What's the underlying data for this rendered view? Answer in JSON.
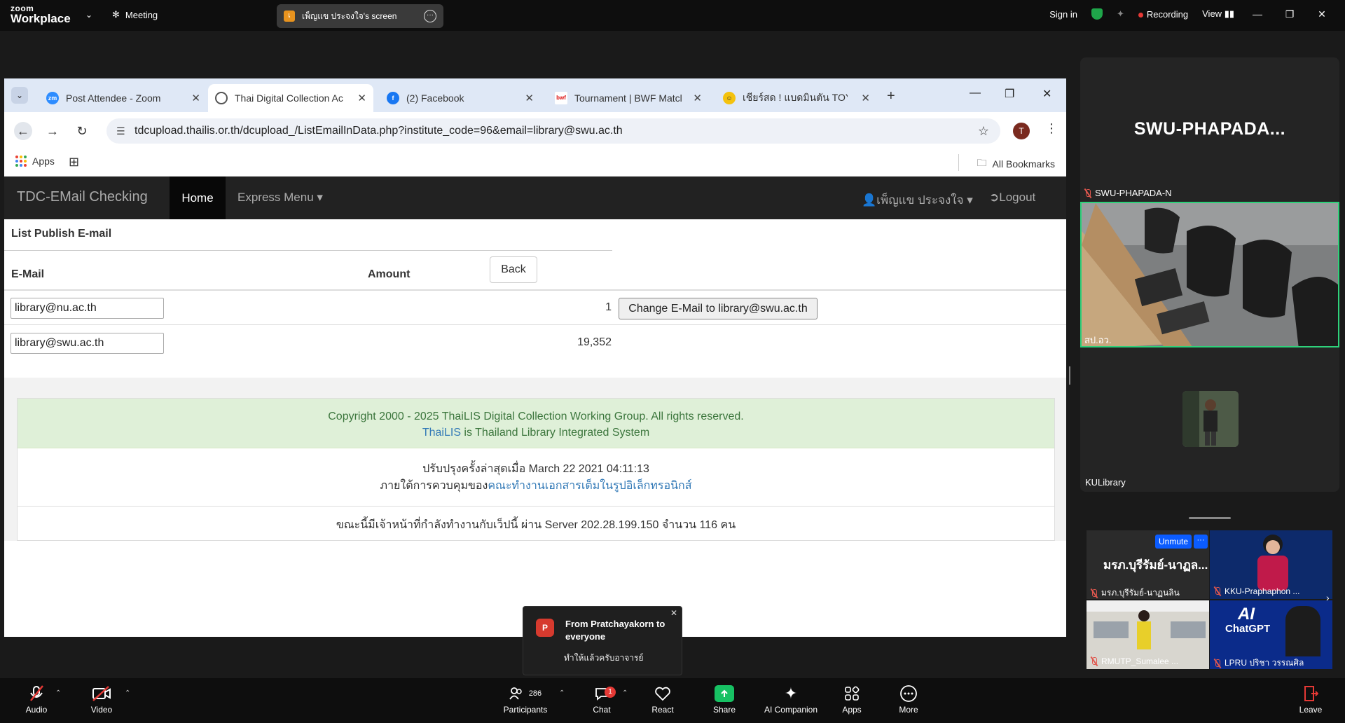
{
  "zoom": {
    "logo_small": "zoom",
    "logo_big": "Workplace",
    "meeting_label": "Meeting",
    "share_badge": "เ",
    "share_text": "เพ็ญแข ประจงใจ's screen",
    "sign_in": "Sign in",
    "recording": "Recording",
    "view": "View"
  },
  "browser": {
    "tabs": [
      {
        "title": "Post Attendee - Zoom",
        "favicon": "zm"
      },
      {
        "title": "Thai Digital Collection Ac",
        "favicon": "globe"
      },
      {
        "title": "(2) Facebook",
        "favicon": "f"
      },
      {
        "title": "Tournament | BWF Matcl",
        "favicon": "bwf"
      },
      {
        "title": "เชียร์สด ! แบดมินตัน TOYOT",
        "favicon": "emoji"
      }
    ],
    "url": "tdcupload.thailis.or.th/dcupload_/ListEmailInData.php?institute_code=96&email=library@swu.ac.th",
    "profile_initial": "T",
    "bookmarks_apps": "Apps",
    "all_bookmarks": "All Bookmarks"
  },
  "site": {
    "brand": "TDC-EMail Checking",
    "home": "Home",
    "express_menu": "Express Menu",
    "user": "เพ็ญแข ประจงใจ",
    "logout": "Logout",
    "list_title": "List Publish E-mail",
    "back": "Back",
    "col_email": "E-Mail",
    "col_amount": "Amount",
    "rows": [
      {
        "email": "library@nu.ac.th",
        "amount": "1",
        "action": "Change E-Mail to library@swu.ac.th"
      },
      {
        "email": "library@swu.ac.th",
        "amount": "19,352",
        "action": ""
      }
    ],
    "footer": {
      "copyright": "Copyright 2000 - 2025 ThaiLIS Digital Collection Working Group. All rights reserved.",
      "thailis_link": "ThaiLIS",
      "thailis_rest": " is Thailand Library Integrated System",
      "updated": "ปรับปรุงครั้งล่าสุดเมื่อ March 22 2021 04:11:13",
      "control_prefix": "ภายใต้การควบคุมของ",
      "control_link": "คณะทำงานเอกสารเต็มในรูปอิเล็กทรอนิกส์",
      "online": "ขณะนี้มีเจ้าหน้าที่กำลังทำงานกับเว็ปนี้ ผ่าน Server 202.28.199.150 จำนวน 116 คน"
    }
  },
  "gallery": {
    "top_tile_name": "SWU-PHAPADA...",
    "top_tile_label": "SWU-PHAPADA-N",
    "video_label": "สป.อว.",
    "kul_label": "KULibrary",
    "thumbs": [
      {
        "name": "มรภ.บุรีรัมย์-นาฏล...",
        "label": "มรภ.บุรีรัมย์-นาฏนลิน"
      },
      {
        "label": "KKU-Praphaphon ..."
      },
      {
        "label": "RMUTP_Sumalee ..."
      },
      {
        "label": "LPRU ปริชา วรรณศิล",
        "title": "AI",
        "subtitle": "ChatGPT"
      }
    ],
    "unmute": "Unmute"
  },
  "toast": {
    "initial": "P",
    "from": "From Pratchayakorn to everyone",
    "message": "ทำให้แล้วครับอาจารย์"
  },
  "toolbar": {
    "audio": "Audio",
    "video": "Video",
    "participants": "Participants",
    "participants_count": "286",
    "chat": "Chat",
    "chat_badge": "1",
    "react": "React",
    "share": "Share",
    "ai_companion": "AI Companion",
    "apps": "Apps",
    "more": "More",
    "leave": "Leave"
  }
}
